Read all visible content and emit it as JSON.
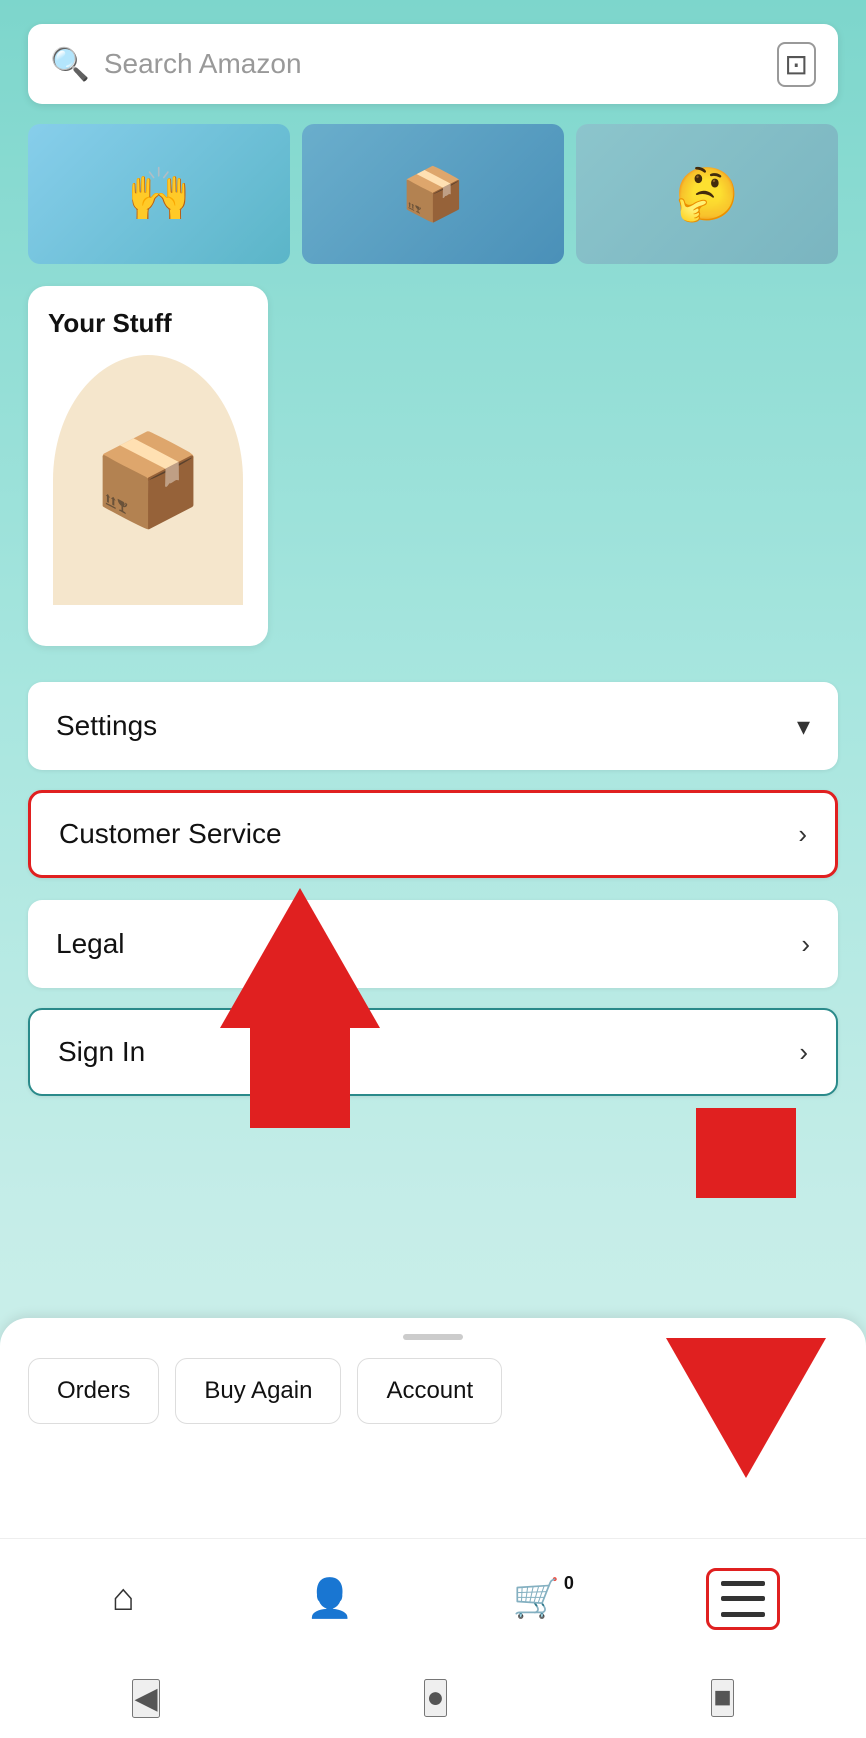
{
  "search": {
    "placeholder": "Search Amazon",
    "search_icon": "🔍",
    "camera_icon": "⊡"
  },
  "product_images": [
    {
      "alt": "hands image",
      "emoji": "🙌"
    },
    {
      "alt": "box delivery",
      "emoji": "📦"
    },
    {
      "alt": "person thinking",
      "emoji": "🤔"
    }
  ],
  "your_stuff": {
    "title": "Your Stuff",
    "box_emoji": "📦"
  },
  "menu_items": [
    {
      "label": "Settings",
      "chevron": "▾",
      "type": "dropdown"
    },
    {
      "label": "Customer Service",
      "chevron": "›",
      "type": "link",
      "highlighted": true
    },
    {
      "label": "Legal",
      "chevron": "›",
      "type": "link"
    },
    {
      "label": "Sign In",
      "chevron": "›",
      "type": "link",
      "teal_border": true
    }
  ],
  "quick_actions": [
    {
      "label": "Orders"
    },
    {
      "label": "Buy Again"
    },
    {
      "label": "Account"
    }
  ],
  "bottom_nav": [
    {
      "icon": "home",
      "label": "Home"
    },
    {
      "icon": "person",
      "label": "Profile"
    },
    {
      "icon": "cart",
      "label": "Cart",
      "badge": "0"
    },
    {
      "icon": "menu",
      "label": "Menu",
      "active": true
    }
  ],
  "system_nav": [
    {
      "icon": "◀",
      "label": "back"
    },
    {
      "icon": "●",
      "label": "home"
    },
    {
      "icon": "■",
      "label": "recents"
    }
  ],
  "colors": {
    "red_highlight": "#e02020",
    "teal_border": "#2a8a8a",
    "background_gradient_start": "#7dd6cc",
    "background_gradient_end": "#c5ede8"
  }
}
